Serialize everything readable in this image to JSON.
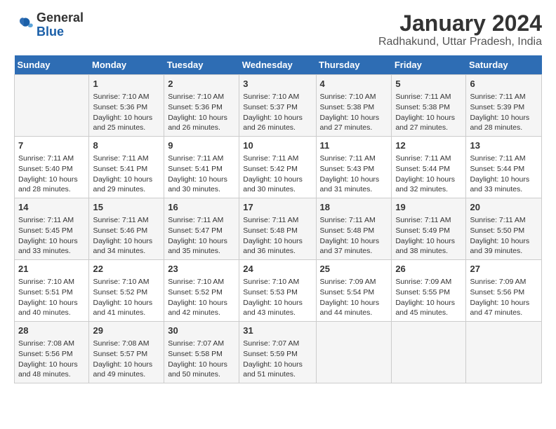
{
  "logo": {
    "general": "General",
    "blue": "Blue"
  },
  "title": "January 2024",
  "subtitle": "Radhakund, Uttar Pradesh, India",
  "days_of_week": [
    "Sunday",
    "Monday",
    "Tuesday",
    "Wednesday",
    "Thursday",
    "Friday",
    "Saturday"
  ],
  "weeks": [
    [
      {
        "num": "",
        "info": ""
      },
      {
        "num": "1",
        "info": "Sunrise: 7:10 AM\nSunset: 5:36 PM\nDaylight: 10 hours\nand 25 minutes."
      },
      {
        "num": "2",
        "info": "Sunrise: 7:10 AM\nSunset: 5:36 PM\nDaylight: 10 hours\nand 26 minutes."
      },
      {
        "num": "3",
        "info": "Sunrise: 7:10 AM\nSunset: 5:37 PM\nDaylight: 10 hours\nand 26 minutes."
      },
      {
        "num": "4",
        "info": "Sunrise: 7:10 AM\nSunset: 5:38 PM\nDaylight: 10 hours\nand 27 minutes."
      },
      {
        "num": "5",
        "info": "Sunrise: 7:11 AM\nSunset: 5:38 PM\nDaylight: 10 hours\nand 27 minutes."
      },
      {
        "num": "6",
        "info": "Sunrise: 7:11 AM\nSunset: 5:39 PM\nDaylight: 10 hours\nand 28 minutes."
      }
    ],
    [
      {
        "num": "7",
        "info": "Sunrise: 7:11 AM\nSunset: 5:40 PM\nDaylight: 10 hours\nand 28 minutes."
      },
      {
        "num": "8",
        "info": "Sunrise: 7:11 AM\nSunset: 5:41 PM\nDaylight: 10 hours\nand 29 minutes."
      },
      {
        "num": "9",
        "info": "Sunrise: 7:11 AM\nSunset: 5:41 PM\nDaylight: 10 hours\nand 30 minutes."
      },
      {
        "num": "10",
        "info": "Sunrise: 7:11 AM\nSunset: 5:42 PM\nDaylight: 10 hours\nand 30 minutes."
      },
      {
        "num": "11",
        "info": "Sunrise: 7:11 AM\nSunset: 5:43 PM\nDaylight: 10 hours\nand 31 minutes."
      },
      {
        "num": "12",
        "info": "Sunrise: 7:11 AM\nSunset: 5:44 PM\nDaylight: 10 hours\nand 32 minutes."
      },
      {
        "num": "13",
        "info": "Sunrise: 7:11 AM\nSunset: 5:44 PM\nDaylight: 10 hours\nand 33 minutes."
      }
    ],
    [
      {
        "num": "14",
        "info": "Sunrise: 7:11 AM\nSunset: 5:45 PM\nDaylight: 10 hours\nand 33 minutes."
      },
      {
        "num": "15",
        "info": "Sunrise: 7:11 AM\nSunset: 5:46 PM\nDaylight: 10 hours\nand 34 minutes."
      },
      {
        "num": "16",
        "info": "Sunrise: 7:11 AM\nSunset: 5:47 PM\nDaylight: 10 hours\nand 35 minutes."
      },
      {
        "num": "17",
        "info": "Sunrise: 7:11 AM\nSunset: 5:48 PM\nDaylight: 10 hours\nand 36 minutes."
      },
      {
        "num": "18",
        "info": "Sunrise: 7:11 AM\nSunset: 5:48 PM\nDaylight: 10 hours\nand 37 minutes."
      },
      {
        "num": "19",
        "info": "Sunrise: 7:11 AM\nSunset: 5:49 PM\nDaylight: 10 hours\nand 38 minutes."
      },
      {
        "num": "20",
        "info": "Sunrise: 7:11 AM\nSunset: 5:50 PM\nDaylight: 10 hours\nand 39 minutes."
      }
    ],
    [
      {
        "num": "21",
        "info": "Sunrise: 7:10 AM\nSunset: 5:51 PM\nDaylight: 10 hours\nand 40 minutes."
      },
      {
        "num": "22",
        "info": "Sunrise: 7:10 AM\nSunset: 5:52 PM\nDaylight: 10 hours\nand 41 minutes."
      },
      {
        "num": "23",
        "info": "Sunrise: 7:10 AM\nSunset: 5:52 PM\nDaylight: 10 hours\nand 42 minutes."
      },
      {
        "num": "24",
        "info": "Sunrise: 7:10 AM\nSunset: 5:53 PM\nDaylight: 10 hours\nand 43 minutes."
      },
      {
        "num": "25",
        "info": "Sunrise: 7:09 AM\nSunset: 5:54 PM\nDaylight: 10 hours\nand 44 minutes."
      },
      {
        "num": "26",
        "info": "Sunrise: 7:09 AM\nSunset: 5:55 PM\nDaylight: 10 hours\nand 45 minutes."
      },
      {
        "num": "27",
        "info": "Sunrise: 7:09 AM\nSunset: 5:56 PM\nDaylight: 10 hours\nand 47 minutes."
      }
    ],
    [
      {
        "num": "28",
        "info": "Sunrise: 7:08 AM\nSunset: 5:56 PM\nDaylight: 10 hours\nand 48 minutes."
      },
      {
        "num": "29",
        "info": "Sunrise: 7:08 AM\nSunset: 5:57 PM\nDaylight: 10 hours\nand 49 minutes."
      },
      {
        "num": "30",
        "info": "Sunrise: 7:07 AM\nSunset: 5:58 PM\nDaylight: 10 hours\nand 50 minutes."
      },
      {
        "num": "31",
        "info": "Sunrise: 7:07 AM\nSunset: 5:59 PM\nDaylight: 10 hours\nand 51 minutes."
      },
      {
        "num": "",
        "info": ""
      },
      {
        "num": "",
        "info": ""
      },
      {
        "num": "",
        "info": ""
      }
    ]
  ]
}
